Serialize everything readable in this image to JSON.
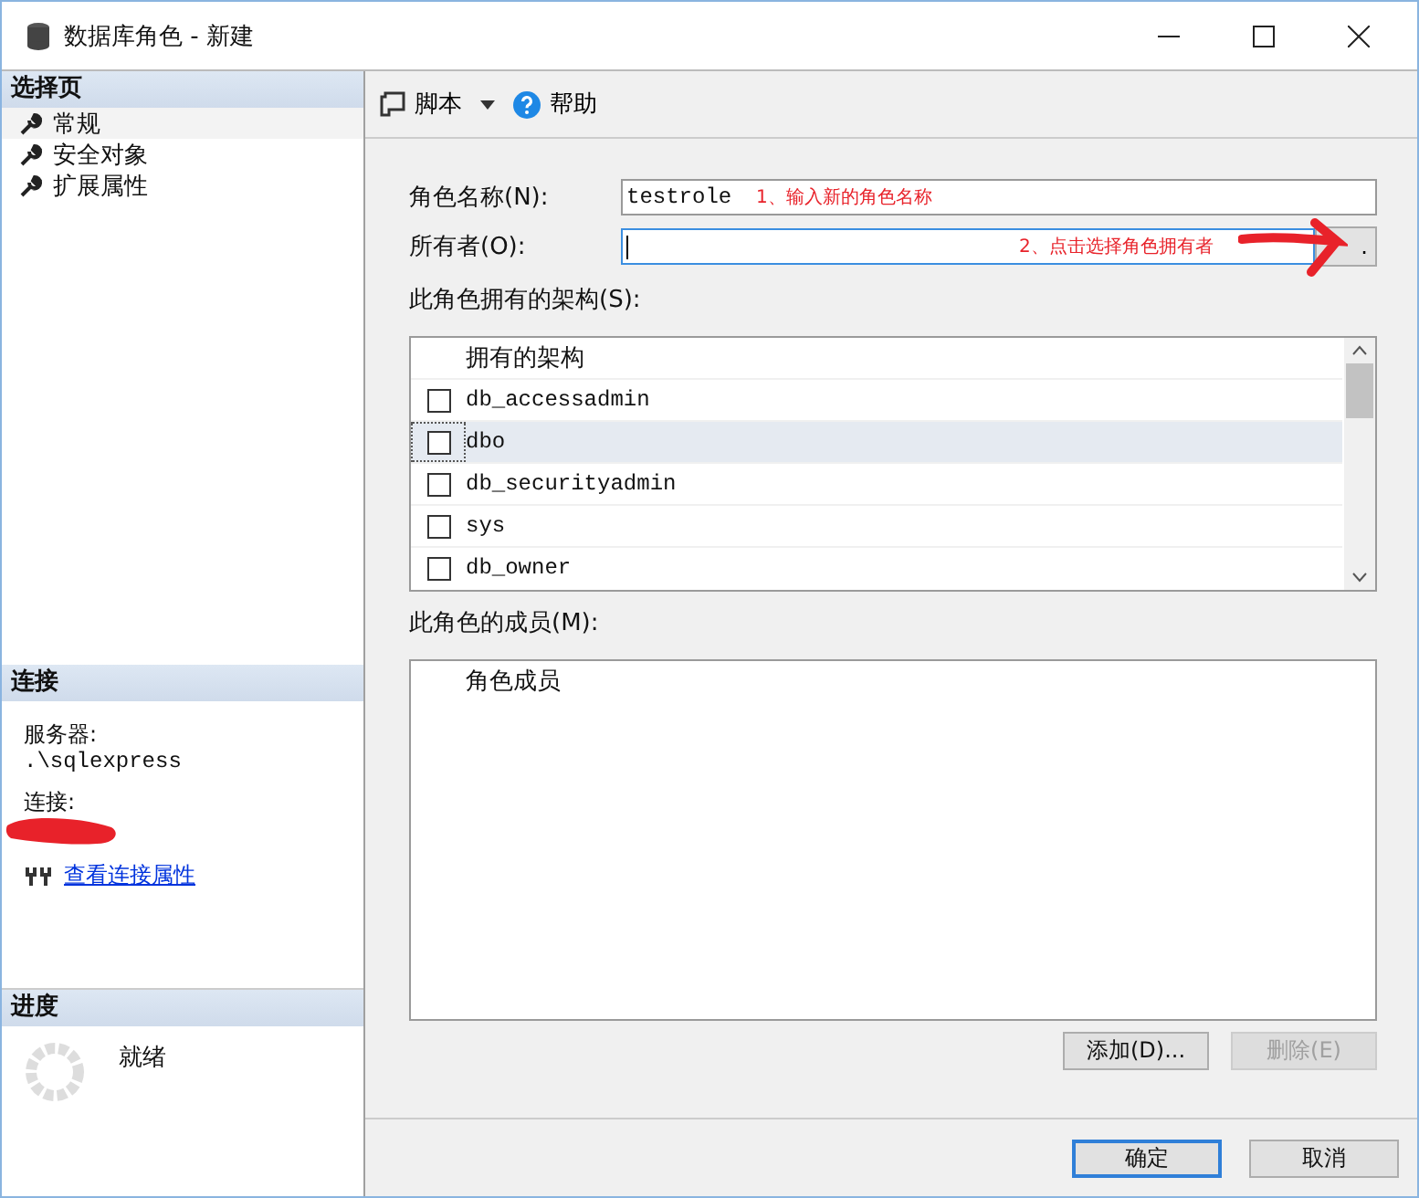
{
  "window": {
    "title": "数据库角色 - 新建"
  },
  "sidebar": {
    "pages_header": "选择页",
    "pages": [
      {
        "label": "常规",
        "selected": true
      },
      {
        "label": "安全对象",
        "selected": false
      },
      {
        "label": "扩展属性",
        "selected": false
      }
    ],
    "connection": {
      "header": "连接",
      "server_label": "服务器:",
      "server": ".\\sqlexpress",
      "connection_label": "连接:",
      "link": "查看连接属性"
    },
    "progress": {
      "header": "进度",
      "status": "就绪"
    }
  },
  "toolbar": {
    "script": "脚本",
    "help": "帮助"
  },
  "form": {
    "role_name_label": "角色名称(N):",
    "role_name": "testrole",
    "role_name_note": "1、输入新的角色名称",
    "owner_label": "所有者(O):",
    "owner_note": "2、点击选择角色拥有者",
    "browse": "."
  },
  "schemas": {
    "label": "此角色拥有的架构(S):",
    "column": "拥有的架构",
    "rows": [
      {
        "name": "db_accessadmin",
        "checked": false,
        "selected": false
      },
      {
        "name": "dbo",
        "checked": false,
        "selected": true
      },
      {
        "name": "db_securityadmin",
        "checked": false,
        "selected": false
      },
      {
        "name": "sys",
        "checked": false,
        "selected": false
      },
      {
        "name": "db_owner",
        "checked": false,
        "selected": false
      }
    ]
  },
  "members": {
    "label": "此角色的成员(M):",
    "column": "角色成员",
    "add": "添加(D)...",
    "remove": "删除(E)",
    "remove_disabled": true
  },
  "footer": {
    "ok": "确定",
    "cancel": "取消"
  }
}
